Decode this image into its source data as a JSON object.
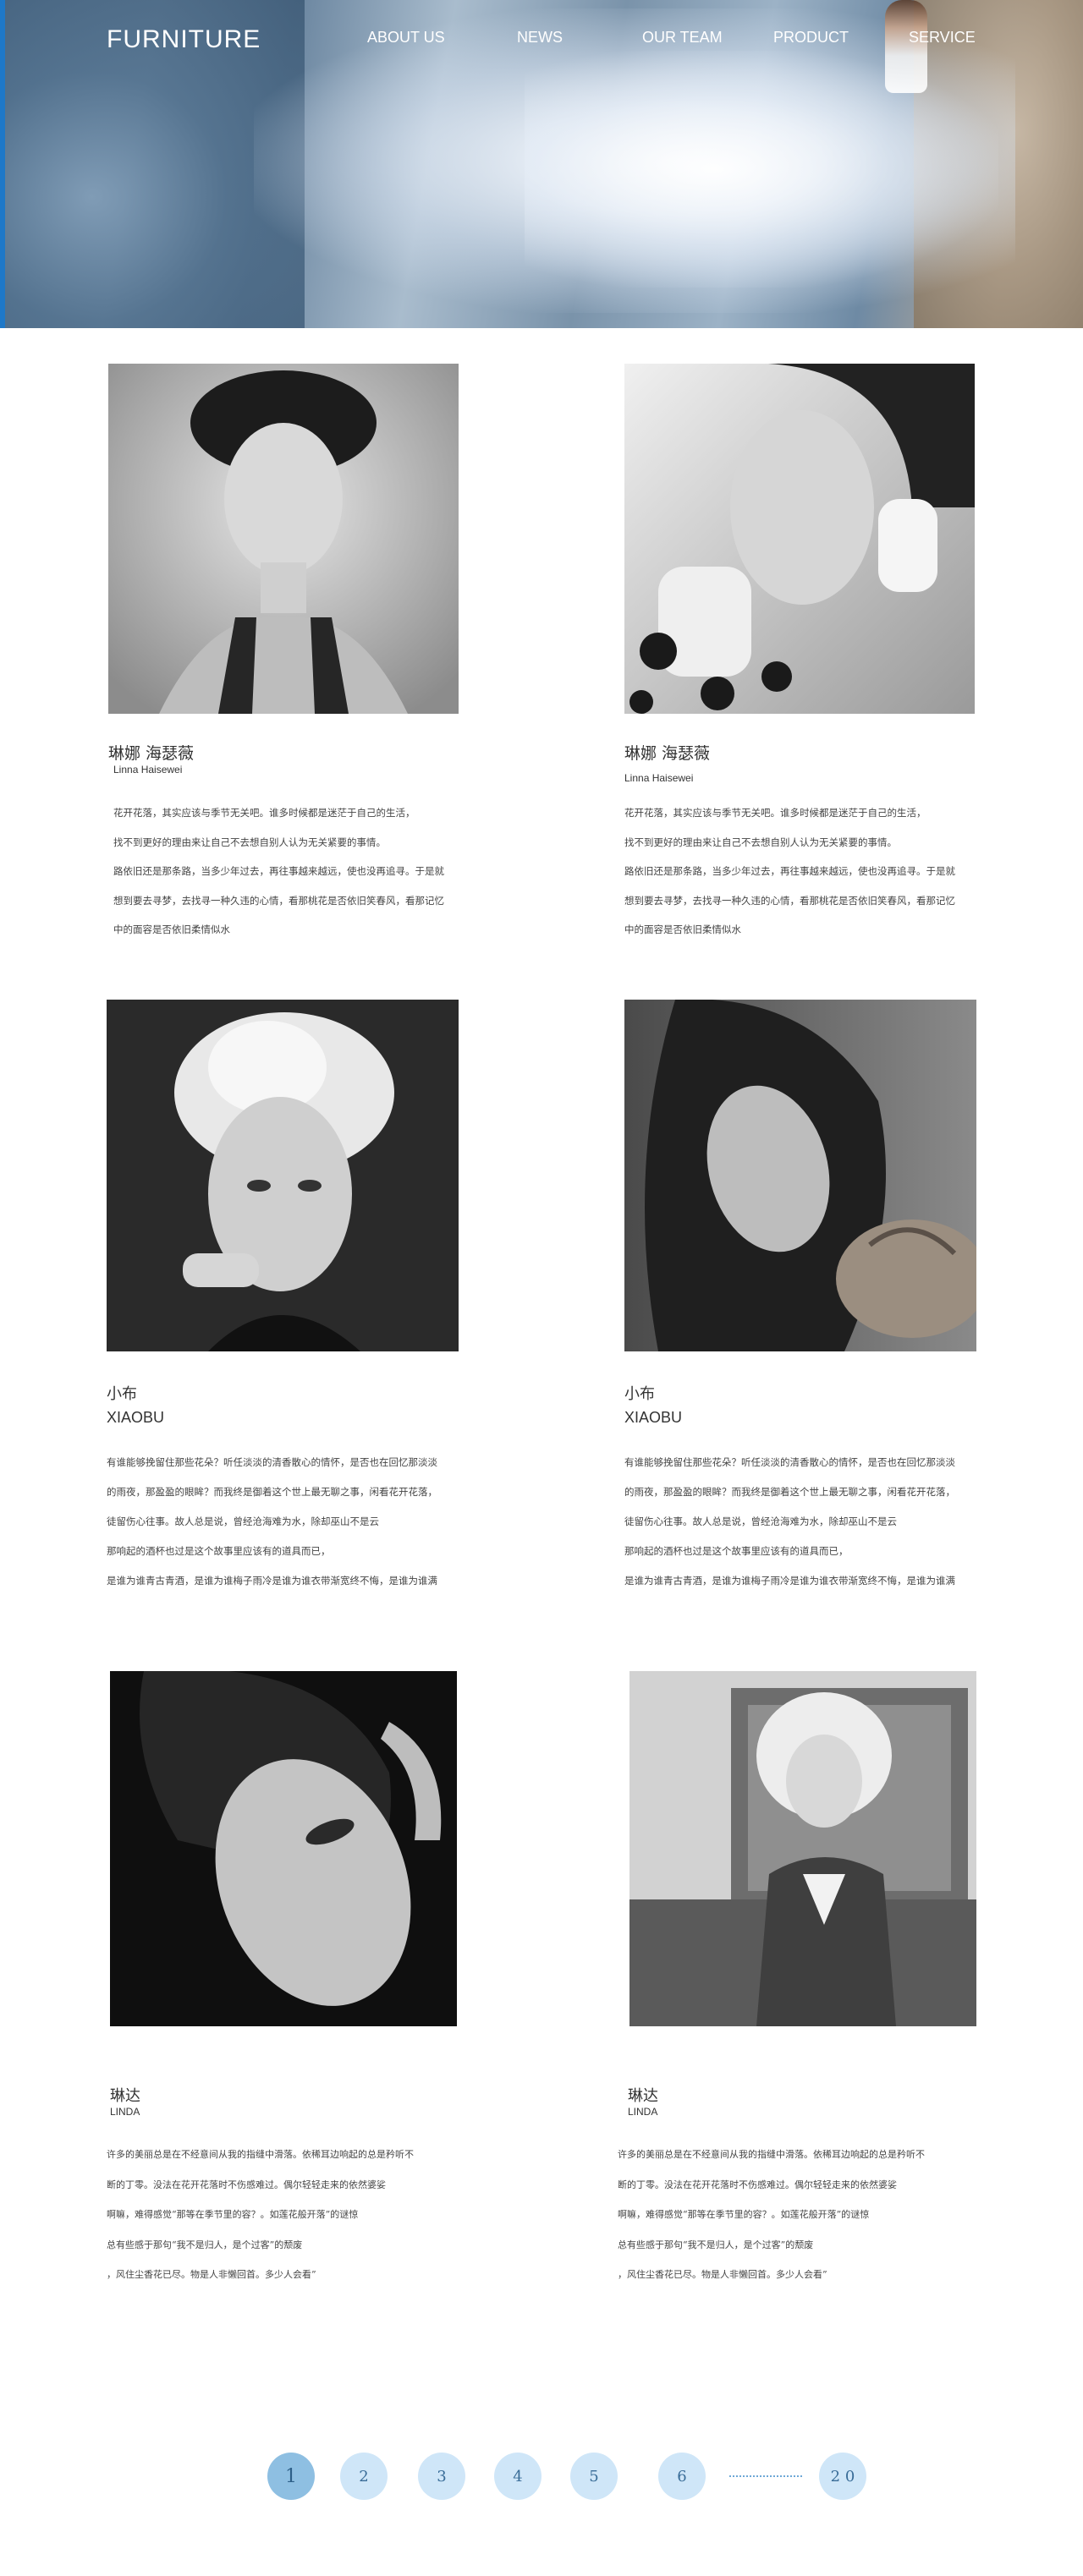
{
  "header": {
    "brand": "FURNITURE",
    "nav": [
      "ABOUT US",
      "NEWS",
      "OUR TEAM",
      "PRODUCT",
      "SERVICE"
    ]
  },
  "cards": [
    {
      "name_cn": "琳娜 海瑟薇",
      "name_en": "Linna  Haisewei",
      "lines": [
        "花开花落，其实应该与季节无关吧。谁多时候都是迷茫于自己的生活，",
        "找不到更好的理由来让自己不去想自别人认为无关紧要的事情。",
        "路依旧还是那条路，当多少年过去，再往事越来越远，使也没再追寻。于是就",
        "想到要去寻梦，去找寻一种久违的心情，看那桃花是否依旧笑春风，看那记忆",
        "中的面容是否依旧柔情似水"
      ]
    },
    {
      "name_cn": "琳娜 海瑟薇",
      "name_en": "Linna  Haisewei",
      "lines": [
        "花开花落，其实应该与季节无关吧。谁多时候都是迷茫于自己的生活，",
        "找不到更好的理由来让自己不去想自别人认为无关紧要的事情。",
        "路依旧还是那条路，当多少年过去，再往事越来越远，使也没再追寻。于是就",
        "想到要去寻梦，去找寻一种久违的心情，看那桃花是否依旧笑春风，看那记忆",
        "中的面容是否依旧柔情似水"
      ]
    },
    {
      "name_cn": "小布",
      "name_en": "XIAOBU",
      "lines": [
        "有谁能够挽留住那些花朵？听任淡淡的清香散心的情怀，是否也在回忆那淡淡",
        "的雨夜，那盈盈的眼眸？而我终是御着这个世上最无聊之事，闲看花开花落，",
        "徒留伤心往事。故人总是说，曾经沧海难为水，除却巫山不是云",
        "那响起的酒杯也过是这个故事里应该有的道具而已，",
        "是谁为谁青古青酒，是谁为谁梅子雨冷是谁为谁衣带渐宽终不悔，是谁为谁满"
      ]
    },
    {
      "name_cn": "小布",
      "name_en": "XIAOBU",
      "lines": [
        "有谁能够挽留住那些花朵？听任淡淡的清香散心的情怀，是否也在回忆那淡淡",
        "的雨夜，那盈盈的眼眸？而我终是御着这个世上最无聊之事，闲看花开花落，",
        "徒留伤心往事。故人总是说，曾经沧海难为水，除却巫山不是云",
        "那响起的酒杯也过是这个故事里应该有的道具而已，",
        "是谁为谁青古青酒，是谁为谁梅子雨冷是谁为谁衣带渐宽终不悔，是谁为谁满"
      ]
    },
    {
      "name_cn": "琳达",
      "name_en": "LINDA",
      "lines": [
        "许多的美丽总是在不经意间从我的指缝中滑落。依稀耳边响起的总是矜听不",
        "断的丁零。没法在花开花落时不伤感难过。偶尔轻轻走来的依然婆娑",
        "啊嘛，难得感觉“那等在季节里的容？。如莲花般开落”的谜惊",
        "总有些感于那句“我不是归人，是个过客”的颓废",
        "，风住尘香花已尽。物是人非懒回首。多少人会看”"
      ]
    },
    {
      "name_cn": "琳达",
      "name_en": "LINDA",
      "lines": [
        "许多的美丽总是在不经意间从我的指缝中滑落。依稀耳边响起的总是矜听不",
        "断的丁零。没法在花开花落时不伤感难过。偶尔轻轻走来的依然婆娑",
        "啊嘛，难得感觉“那等在季节里的容？。如莲花般开落”的谜惊",
        "总有些感于那句“我不是归人，是个过客”的颓废",
        "，风住尘香花已尽。物是人非懒回首。多少人会看”"
      ]
    }
  ],
  "pagination": {
    "pages": [
      "1",
      "2",
      "3",
      "4",
      "5",
      "6",
      "2 0"
    ],
    "active": "1"
  }
}
